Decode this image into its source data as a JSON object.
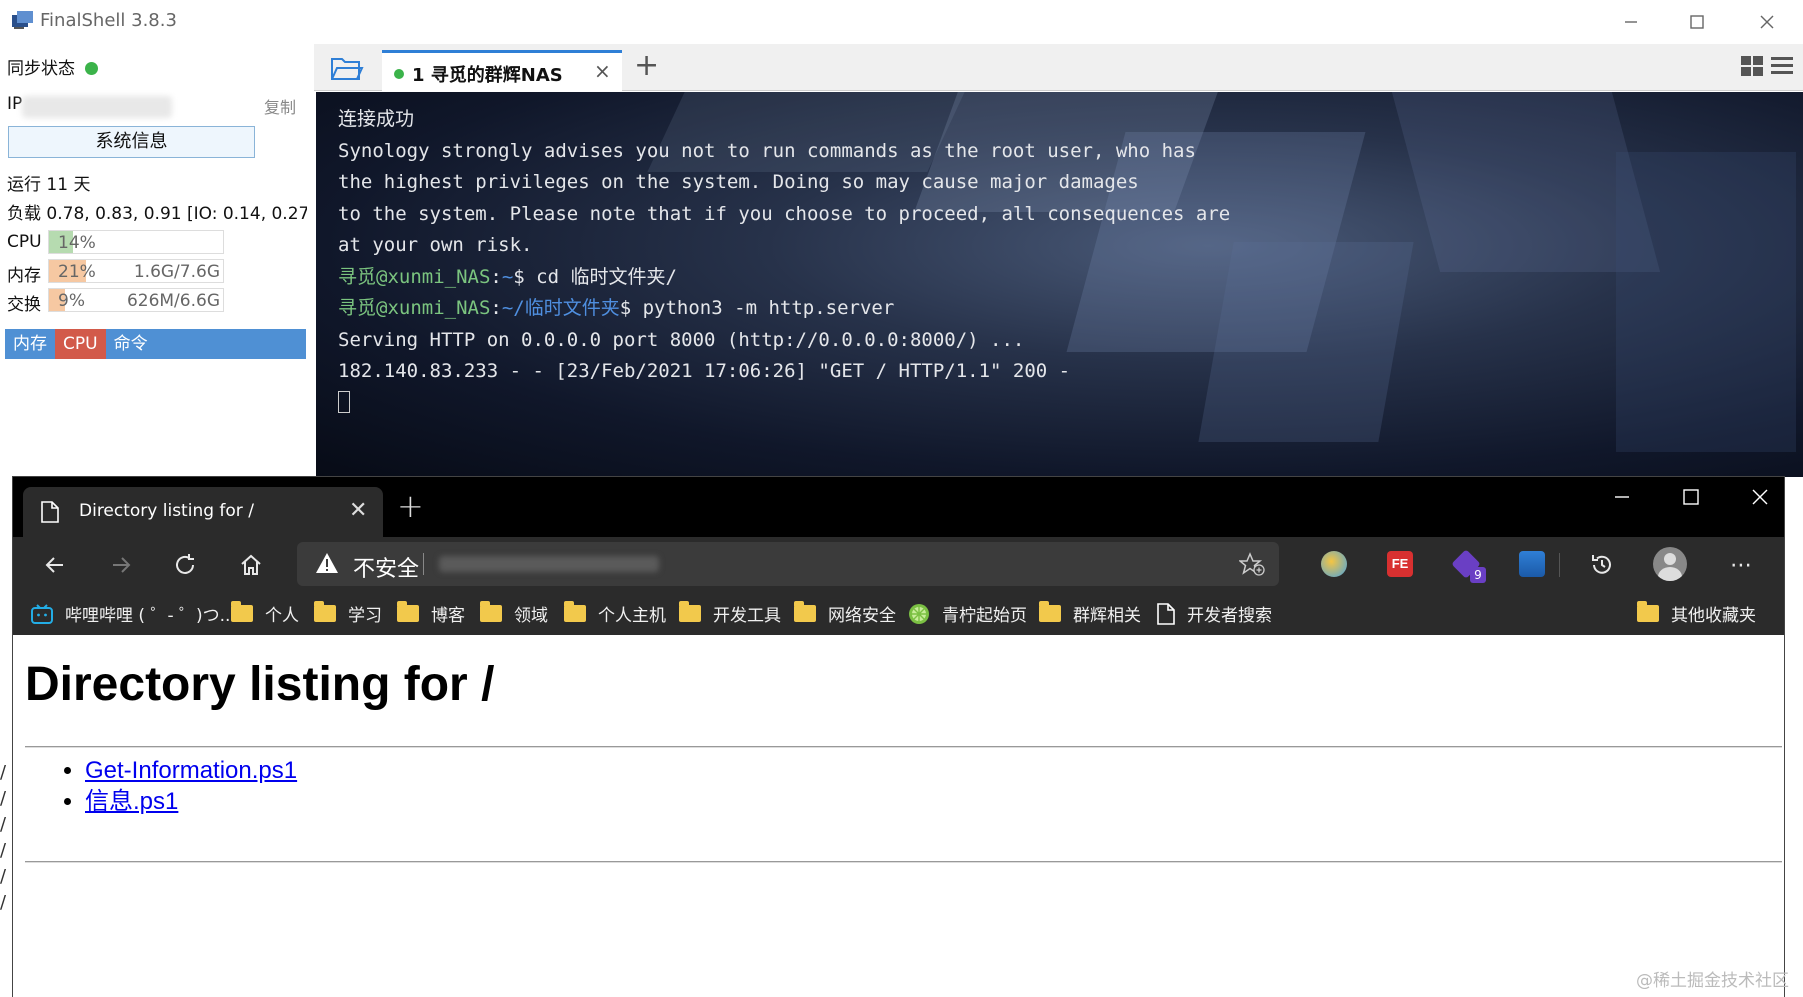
{
  "finalshell": {
    "title": "FinalShell 3.8.3",
    "sidebar": {
      "sync_label": "同步状态",
      "ip_label": "IP",
      "copy_label": "复制",
      "sysinfo_button": "系统信息",
      "uptime": "运行 11 天",
      "load": "负载 0.78, 0.83, 0.91 [IO: 0.14, 0.27..",
      "meters": [
        {
          "label": "CPU",
          "percent": "14%",
          "amount": "",
          "fill_fraction": 0.14,
          "color": "#b6dbb0"
        },
        {
          "label": "内存",
          "percent": "21%",
          "amount": "1.6G/7.6G",
          "fill_fraction": 0.21,
          "color": "#f6c8a2"
        },
        {
          "label": "交换",
          "percent": "9%",
          "amount": "626M/6.6G",
          "fill_fraction": 0.09,
          "color": "#f6c8a2"
        }
      ],
      "process_tabs": [
        "内存",
        "CPU",
        "命令"
      ]
    },
    "session_tab": "1 寻觅的群辉NAS",
    "terminal": {
      "lines": [
        "连接成功",
        "",
        "Synology strongly advises you not to run commands as the root user, who has",
        "the highest privileges on the system. Doing so may cause major damages",
        "to the system. Please note that if you choose to proceed, all consequences are",
        "at your own risk.",
        ""
      ],
      "prompt1": {
        "user": "寻觅@xunmi_NAS",
        "sep": ":",
        "path": "~",
        "cmd": "$ cd 临时文件夹/"
      },
      "prompt2": {
        "user": "寻觅@xunmi_NAS",
        "sep": ":",
        "path": "~/临时文件夹",
        "cmd": "$ python3 -m http.server"
      },
      "output": [
        "Serving HTTP on 0.0.0.0 port 8000 (http://0.0.0.0:8000/) ...",
        "182.140.83.233 - - [23/Feb/2021 17:06:26] \"GET / HTTP/1.1\" 200 -"
      ]
    }
  },
  "browser": {
    "tab_title": "Directory listing for /",
    "security_label": "不安全",
    "extension_badge": "9",
    "bookmarks": [
      {
        "label": "哔哩哔哩 ( ゜- ゜)つ...",
        "icon": "bilibili-icon"
      },
      {
        "label": "个人",
        "icon": "folder-icon"
      },
      {
        "label": "学习",
        "icon": "folder-icon"
      },
      {
        "label": "博客",
        "icon": "folder-icon"
      },
      {
        "label": "领域",
        "icon": "folder-icon"
      },
      {
        "label": "个人主机",
        "icon": "folder-icon"
      },
      {
        "label": "开发工具",
        "icon": "folder-icon"
      },
      {
        "label": "网络安全",
        "icon": "folder-icon"
      },
      {
        "label": "青柠起始页",
        "icon": "lime-icon"
      },
      {
        "label": "群辉相关",
        "icon": "folder-icon"
      },
      {
        "label": "开发者搜索",
        "icon": "page-icon"
      }
    ],
    "other_bookmarks": "其他收藏夹",
    "page": {
      "heading": "Directory listing for /",
      "files": [
        "Get-Information.ps1",
        "信息.ps1"
      ]
    }
  },
  "watermark": "@稀土掘金技术社区",
  "left_edge_glyphs": [
    "/",
    "/",
    "/",
    "/",
    "/",
    "/"
  ]
}
